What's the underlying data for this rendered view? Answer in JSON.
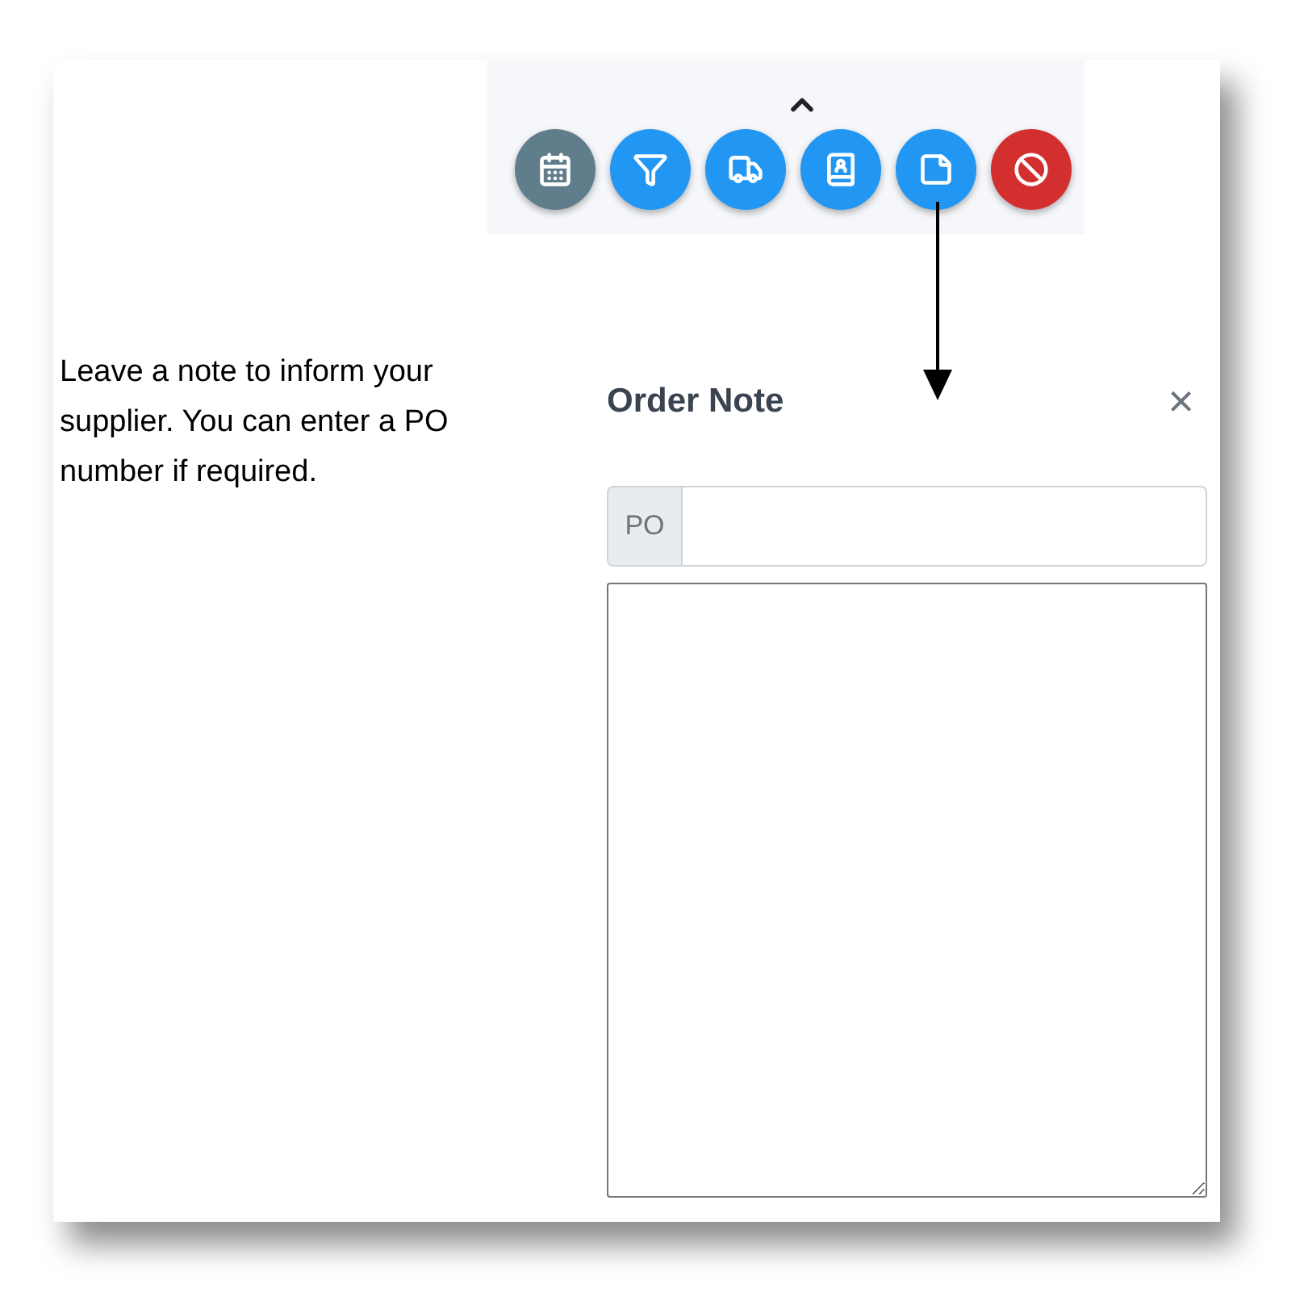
{
  "toolbar": {
    "buttons": [
      {
        "kind": "calendar",
        "color": "#607d8b"
      },
      {
        "kind": "filter",
        "color": "#2196f3"
      },
      {
        "kind": "truck",
        "color": "#2196f3"
      },
      {
        "kind": "contacts",
        "color": "#2196f3"
      },
      {
        "kind": "note",
        "color": "#2196f3"
      },
      {
        "kind": "cancel",
        "color": "#d32f2f"
      }
    ]
  },
  "caption": "Leave a note to inform your supplier. You can enter a PO number if required.",
  "dialog": {
    "title": "Order Note",
    "close": "×",
    "po_field": {
      "prefix": "PO"
    }
  }
}
